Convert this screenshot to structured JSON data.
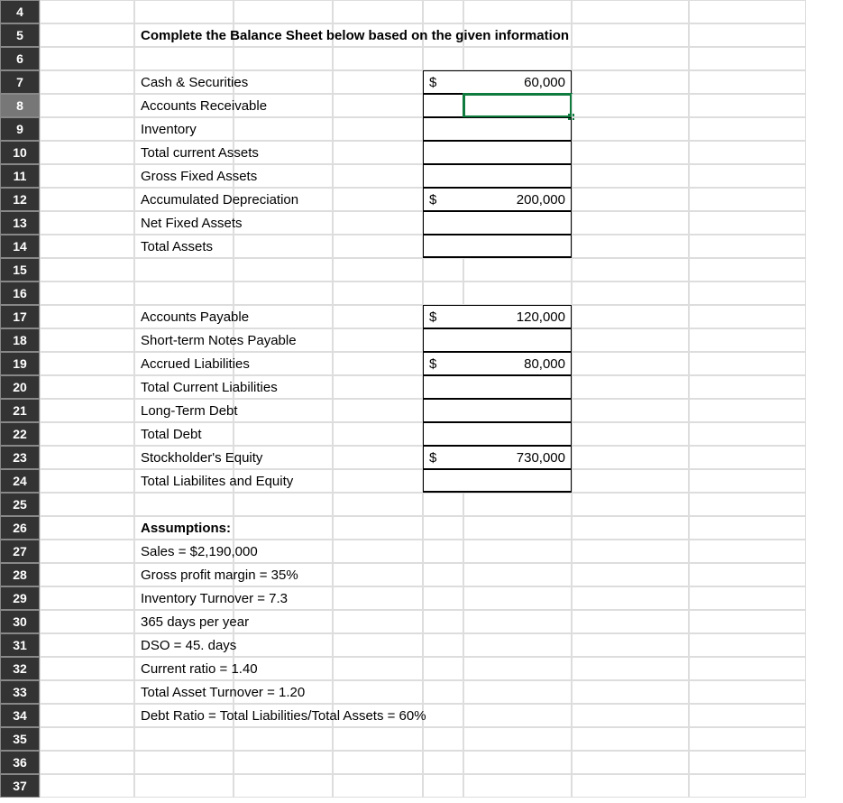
{
  "title": "Complete the Balance Sheet below based on the given information",
  "rows": {
    "r4": "4",
    "r5": "5",
    "r6": "6",
    "r7": "7",
    "r8": "8",
    "r9": "9",
    "r10": "10",
    "r11": "11",
    "r12": "12",
    "r13": "13",
    "r14": "14",
    "r15": "15",
    "r16": "16",
    "r17": "17",
    "r18": "18",
    "r19": "19",
    "r20": "20",
    "r21": "21",
    "r22": "22",
    "r23": "23",
    "r24": "24",
    "r25": "25",
    "r26": "26",
    "r27": "27",
    "r28": "28",
    "r29": "29",
    "r30": "30",
    "r31": "31",
    "r32": "32",
    "r33": "33",
    "r34": "34",
    "r35": "35",
    "r36": "36",
    "r37": "37"
  },
  "labels": {
    "cash": "Cash & Securities",
    "ar": "Accounts Receivable",
    "inv": "Inventory",
    "tca": "Total current Assets",
    "gfa": "Gross Fixed Assets",
    "accdep": "Accumulated Depreciation",
    "nfa": "Net Fixed Assets",
    "ta": "Total Assets",
    "ap": "Accounts Payable",
    "stn": "Short-term Notes Payable",
    "accl": "Accrued Liabilities",
    "tcl": "Total Current Liabilities",
    "ltd": "Long-Term Debt",
    "td": "Total Debt",
    "se": "Stockholder's Equity",
    "tle": "Total Liabilites and Equity",
    "assump": "Assumptions:",
    "a1": "Sales = $2,190,000",
    "a2": "Gross profit margin = 35%",
    "a3": "Inventory Turnover = 7.3",
    "a4": "365 days per year",
    "a5": "DSO = 45. days",
    "a6": "Current ratio = 1.40",
    "a7": "Total Asset Turnover = 1.20",
    "a8": "Debt Ratio = Total Liabilities/Total Assets = 60%"
  },
  "currency": "$",
  "values": {
    "cash": "60,000",
    "accdep": "200,000",
    "ap": "120,000",
    "accl": "80,000",
    "se": "730,000"
  }
}
